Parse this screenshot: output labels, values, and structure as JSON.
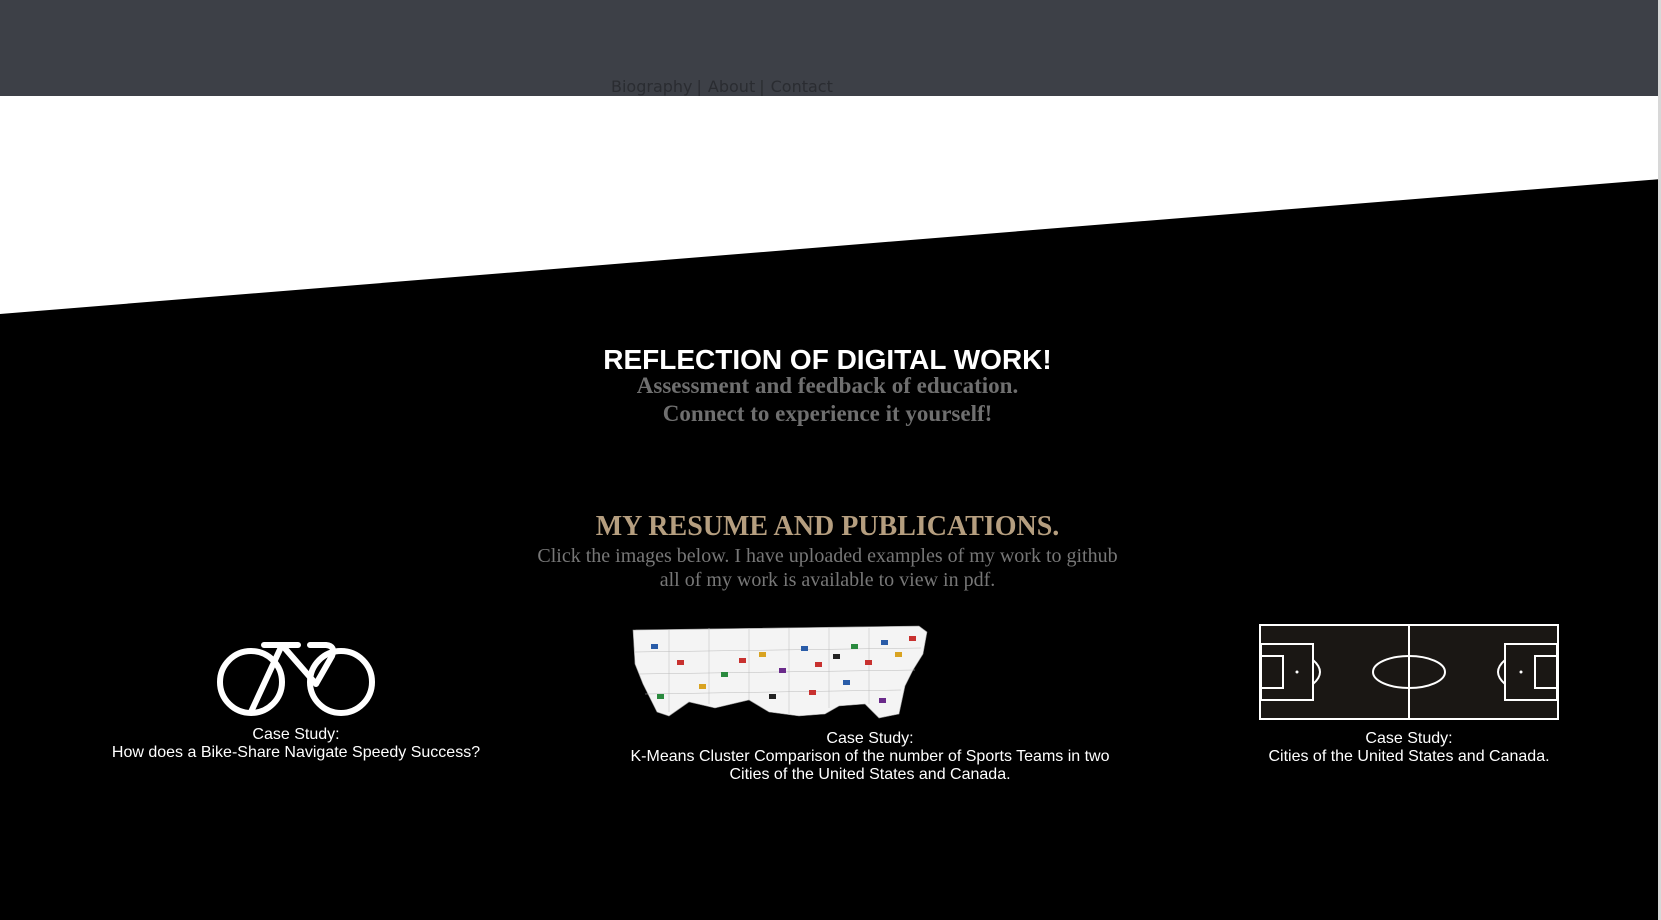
{
  "nav": {
    "items": [
      {
        "label": "Biography"
      },
      {
        "label": "About"
      },
      {
        "label": "Contact"
      }
    ],
    "separator": "|"
  },
  "hero": {
    "title": "REFLECTION OF DIGITAL WORK!",
    "line1": "Assessment and feedback of education.",
    "line2": "Connect to experience it yourself!"
  },
  "resume": {
    "title": "MY RESUME AND PUBLICATIONS.",
    "line1": "Click the images below. I have uploaded examples of my work to github",
    "line2": "all of my work is available to view in pdf."
  },
  "cards": [
    {
      "icon": "bicycle-icon",
      "label": "Case Study:",
      "caption": [
        "How does a Bike-Share Navigate Speedy Success?"
      ]
    },
    {
      "icon": "us-map-image",
      "label": "Case Study:",
      "caption": [
        "K-Means Cluster Comparison of the number of Sports Teams in two",
        "Cities of the United States and Canada."
      ]
    },
    {
      "icon": "soccer-field-image",
      "label": "Case Study:",
      "caption": [
        "Cities of the United States and Canada."
      ]
    }
  ],
  "colors": {
    "topbar": "#3d4047",
    "background": "#000000",
    "accent_gold": "#b59e7f",
    "muted_text": "#6f6f6f"
  }
}
